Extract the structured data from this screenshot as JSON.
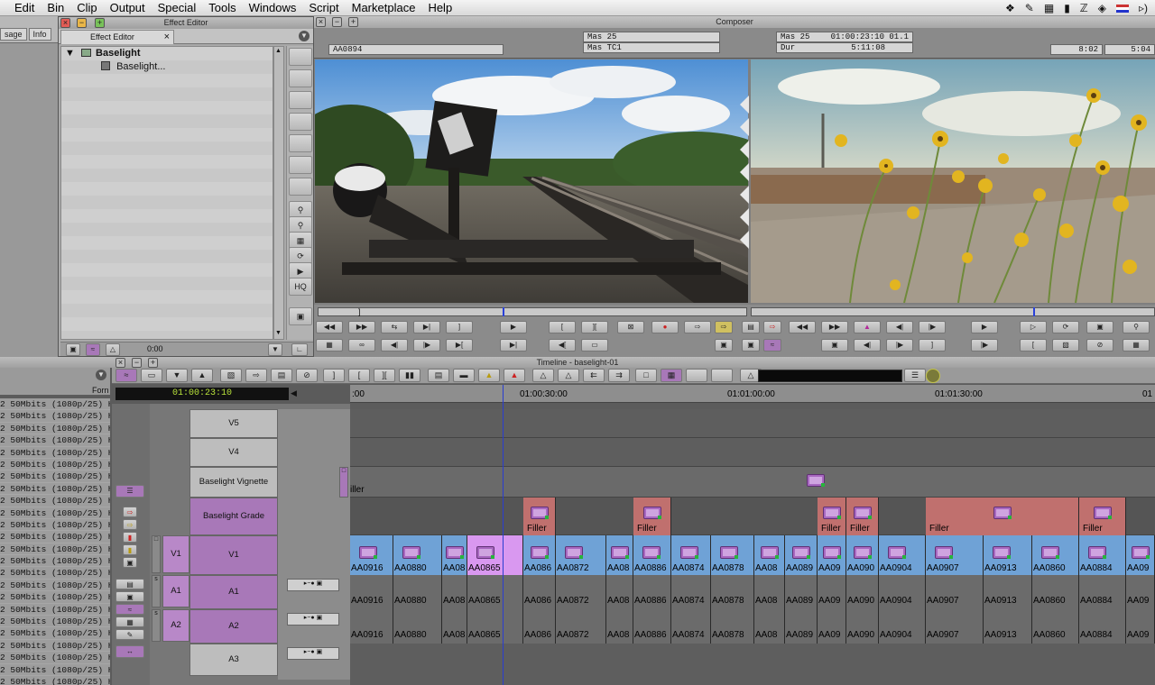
{
  "menubar": {
    "items": [
      "Edit",
      "Bin",
      "Clip",
      "Output",
      "Special",
      "Tools",
      "Windows",
      "Script",
      "Marketplace",
      "Help"
    ]
  },
  "bin": {
    "tabs": [
      "sage",
      "Info"
    ],
    "format_header": "Forn",
    "rows": [
      "2 50Mbits (1080p/25)  H",
      "2 50Mbits (1080p/25)  H",
      "2 50Mbits (1080p/25)  H",
      "2 50Mbits (1080p/25)  H",
      "2 50Mbits (1080p/25)  H",
      "2 50Mbits (1080p/25)  H",
      "2 50Mbits (1080p/25)  H",
      "2 50Mbits (1080p/25)  H",
      "2 50Mbits (1080p/25)  H",
      "2 50Mbits (1080p/25)  H",
      "2 50Mbits (1080p/25)  H",
      "2 50Mbits (1080p/25)  H",
      "2 50Mbits (1080p/25)  H",
      "2 50Mbits (1080p/25)  H",
      "2 50Mbits (1080p/25)  H",
      "2 50Mbits (1080p/25)  H",
      "2 50Mbits (1080p/25)  H",
      "2 50Mbits (1080p/25)  H",
      "2 50Mbits (1080p/25)  H",
      "2 50Mbits (1080p/25)  H",
      "2 50Mbits (1080p/25)  H",
      "2 50Mbits (1080p/25)  H",
      "2 50Mbits (1080p/25)  H",
      "2 50Mbits (1080p/25)  H"
    ]
  },
  "effect_editor": {
    "window_title": "Effect Editor",
    "tab_label": "Effect Editor",
    "effect_name": "Baselight",
    "parameter": "Baselight...",
    "side_hq": "HQ",
    "timecode": "0:00"
  },
  "composer": {
    "title": "Composer",
    "source_clip": "AA0894",
    "center_1": "Mas 25",
    "center_2": "Mas TC1",
    "rec_1": "Mas 25",
    "rec_1_val": "01:00:23:10 01.1",
    "rec_2": "Dur",
    "rec_2_val": "5:11:08",
    "count_1": "8:02",
    "count_2": "5:04"
  },
  "timeline": {
    "title": "Timeline - baselight-01",
    "timecode": "01:00:23:10",
    "ruler": [
      ":00",
      "01:00:30:00",
      "01:01:00:00",
      "01:01:30:00",
      "01"
    ],
    "tracks": {
      "v5": "V5",
      "v4": "V4",
      "vignette": "Baselight Vignette",
      "grade": "Baselight Grade",
      "v1": "V1",
      "a1": "A1",
      "a2": "A2",
      "a3": "A3"
    },
    "filler": "Filler",
    "filler_short": "iller",
    "v1_clips": [
      "AA0916",
      "AA0880",
      "AA08",
      "AA0865",
      "AA086",
      "AA0872",
      "AA08",
      "AA0886",
      "AA0874",
      "AA0878",
      "AA08",
      "AA089",
      "AA09",
      "AA090",
      "AA0904",
      "AA0907",
      "AA0913",
      "AA0860",
      "AA0884",
      "AA09"
    ],
    "audio_clips": [
      "AA0916",
      "AA0880",
      "AA08",
      "AA0865",
      "AA086",
      "AA0872",
      "AA08",
      "AA0886",
      "AA0874",
      "AA0878",
      "AA08",
      "AA089",
      "AA09",
      "AA090",
      "AA0904",
      "AA0907",
      "AA0913",
      "AA0860",
      "AA0884",
      "AA09"
    ]
  },
  "colors": {
    "v1_clip": "#6fa2d6",
    "v1_selected": "#d998f0",
    "audio_clip": "#6b6b6b",
    "grade_clip": "#c0706e",
    "track_selected": "#a878b8"
  }
}
